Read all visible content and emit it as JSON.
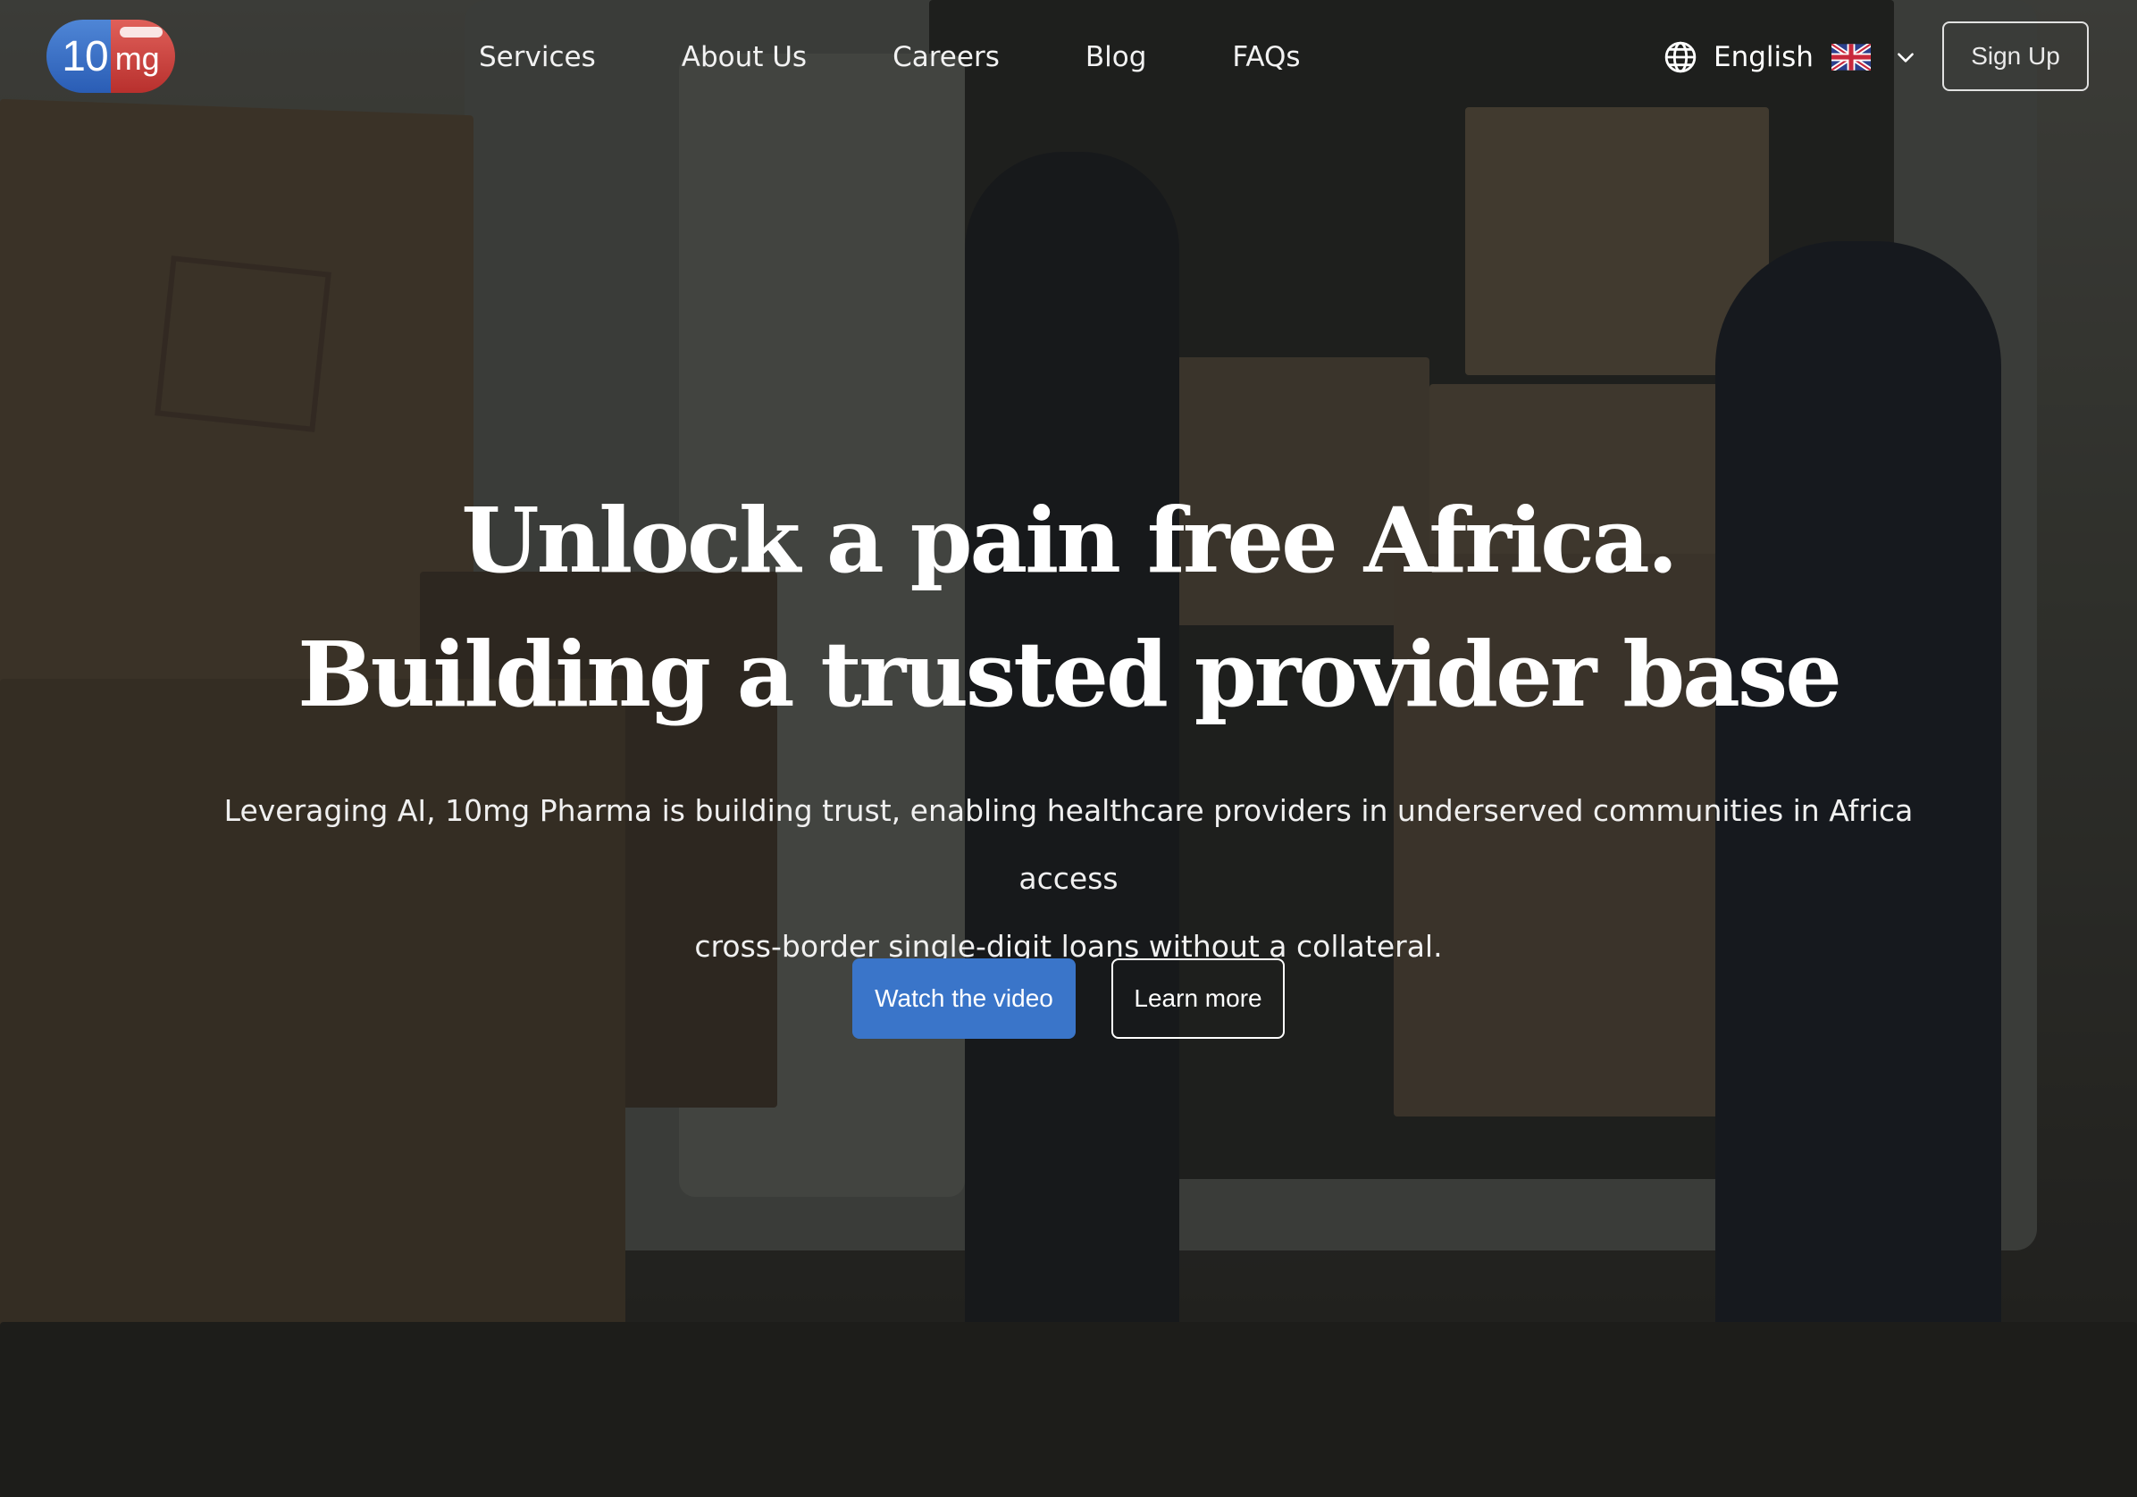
{
  "brand": {
    "logo_number": "10",
    "logo_unit": "mg",
    "logo_colors": {
      "left": "#2a5db5",
      "right": "#b8302d"
    }
  },
  "nav": {
    "items": [
      {
        "label": "Services"
      },
      {
        "label": "About Us"
      },
      {
        "label": "Careers"
      },
      {
        "label": "Blog"
      },
      {
        "label": "FAQs"
      }
    ]
  },
  "language": {
    "icon": "globe-icon",
    "selected": "English",
    "flag": "uk-flag-icon",
    "chevron": "chevron-down-icon"
  },
  "header_actions": {
    "signup_label": "Sign Up"
  },
  "hero": {
    "title_line_1": "Unlock a pain free Africa.",
    "title_line_2": "Building a trusted provider base",
    "subtitle_line_1": "Leveraging AI, 10mg Pharma is building trust, enabling healthcare providers in underserved communities in Africa access",
    "subtitle_line_2": "cross-border single-digit loans without a collateral.",
    "primary_cta": "Watch the video",
    "secondary_cta": "Learn more",
    "accent_color": "#3a75c9"
  }
}
